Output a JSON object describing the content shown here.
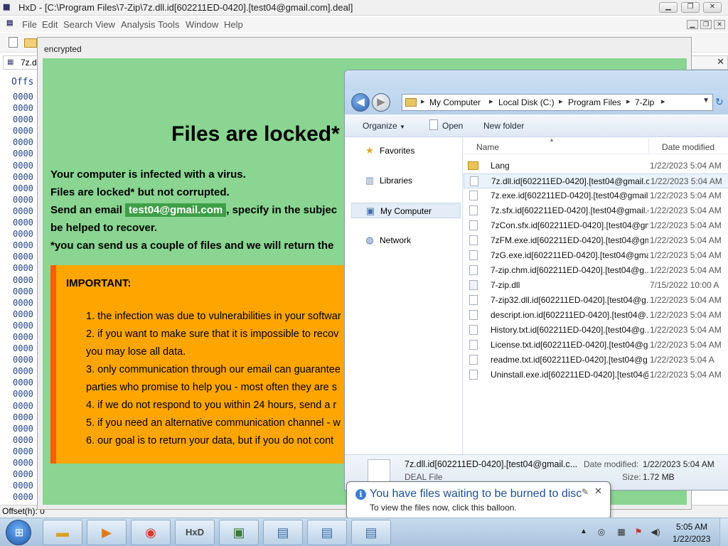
{
  "hxd": {
    "title": "HxD - [C:\\Program Files\\7-Zip\\7z.dll.id[602211ED-0420].[test04@gmail.com].deal]",
    "icon": "hxd-app-icon",
    "menu": [
      "File",
      "Edit",
      "Search",
      "View",
      "Analysis",
      "Tools",
      "Window",
      "Help"
    ],
    "tab_label": "7z.d",
    "offset_header": "Offs",
    "offset_rows": [
      "0000",
      "0000",
      "0000",
      "0000",
      "0000",
      "0000",
      "0000",
      "0000",
      "0000",
      "0000",
      "0000",
      "0000",
      "0000",
      "0000",
      "0000",
      "0000",
      "0000",
      "0000",
      "0000",
      "0000",
      "0000",
      "0000",
      "0000",
      "0000",
      "0000",
      "0000",
      "0000",
      "0000",
      "0000",
      "0000",
      "0000",
      "0000",
      "0000",
      "0000",
      "0000",
      "0000"
    ],
    "status_text": "Offset(h): 0"
  },
  "ransom": {
    "window_title": "encrypted",
    "heading": "Files are locked*",
    "line1": "Your computer is infected with a virus.",
    "line2": "Files are locked* but not corrupted.",
    "line3_pre": "Send an email",
    "email": "test04@gmail.com",
    "line3_post": ", specify in the subjec",
    "line4": "be helped to recover.",
    "line5": "*you can send us a couple of files and we will return the",
    "important_title": "IMPORTANT:",
    "important_lines": [
      "1. the infection was due to vulnerabilities in your softwar",
      "2. if you want to make sure that it is impossible to recov",
      "you may lose all data.",
      "3. only communication through our email can guarantee",
      "parties who promise to help you - most often they are s",
      "4. if we do not respond to you within 24 hours, send a r",
      "5. if you need an alternative communication channel - w",
      "6. our goal is to return your data, but if you do not cont"
    ],
    "colors": {
      "body": "#89d591",
      "important_bg": "#ffa500",
      "important_border": "#ff5a00",
      "email_highlight": "#3e9f47"
    }
  },
  "explorer": {
    "breadcrumb": [
      "My Computer",
      "Local Disk (C:)",
      "Program Files",
      "7-Zip"
    ],
    "commands": {
      "organize": "Organize",
      "open": "Open",
      "new_folder": "New folder"
    },
    "nav": [
      {
        "label": "Favorites",
        "icon": "star-icon"
      },
      {
        "label": "Libraries",
        "icon": "libraries-icon"
      },
      {
        "label": "My Computer",
        "icon": "computer-icon"
      },
      {
        "label": "Network",
        "icon": "network-icon"
      }
    ],
    "columns": {
      "name": "Name",
      "date": "Date modified"
    },
    "files": [
      {
        "name": "Lang",
        "date": "1/22/2023 5:04 AM",
        "type": "folder"
      },
      {
        "name": "7z.dll.id[602211ED-0420].[test04@gmail.c...",
        "date": "1/22/2023 5:04 AM",
        "type": "file",
        "selected": true
      },
      {
        "name": "7z.exe.id[602211ED-0420].[test04@gmail....",
        "date": "1/22/2023 5:04 AM",
        "type": "file"
      },
      {
        "name": "7z.sfx.id[602211ED-0420].[test04@gmail.c...",
        "date": "1/22/2023 5:04 AM",
        "type": "file"
      },
      {
        "name": "7zCon.sfx.id[602211ED-0420].[test04@gm...",
        "date": "1/22/2023 5:04 AM",
        "type": "file"
      },
      {
        "name": "7zFM.exe.id[602211ED-0420].[test04@gm...",
        "date": "1/22/2023 5:04 AM",
        "type": "file"
      },
      {
        "name": "7zG.exe.id[602211ED-0420].[test04@gmai...",
        "date": "1/22/2023 5:04 AM",
        "type": "file"
      },
      {
        "name": "7-zip.chm.id[602211ED-0420].[test04@g...",
        "date": "1/22/2023 5:04 AM",
        "type": "file"
      },
      {
        "name": "7-zip.dll",
        "date": "7/15/2022 10:00 A",
        "type": "dll"
      },
      {
        "name": "7-zip32.dll.id[602211ED-0420].[test04@g...",
        "date": "1/22/2023 5:04 AM",
        "type": "file"
      },
      {
        "name": "descript.ion.id[602211ED-0420].[test04@...",
        "date": "1/22/2023 5:04 AM",
        "type": "file"
      },
      {
        "name": "History.txt.id[602211ED-0420].[test04@g...",
        "date": "1/22/2023 5:04 AM",
        "type": "file"
      },
      {
        "name": "License.txt.id[602211ED-0420].[test04@g...",
        "date": "1/22/2023 5:04 AM",
        "type": "file"
      },
      {
        "name": "readme.txt.id[602211ED-0420].[test04@g...",
        "date": "1/22/2023 5:04 A",
        "type": "file",
        "hover": true
      },
      {
        "name": "Uninstall.exe.id[602211ED-0420].[test04@...",
        "date": "1/22/2023 5:04 AM",
        "type": "file"
      }
    ],
    "details": {
      "name": "7z.dll.id[602211ED-0420].[test04@gmail.c...",
      "type": "DEAL File",
      "date_modified_label": "Date modified:",
      "date_modified": "1/22/2023 5:04 AM",
      "size_label": "Size:",
      "size": "1.72 MB"
    }
  },
  "balloon": {
    "title": "You have files waiting to be burned to disc",
    "text": "To view the files now, click this balloon."
  },
  "taskbar": {
    "apps": [
      {
        "name": "explorer",
        "icon": "folder-icon"
      },
      {
        "name": "media-player",
        "icon": "media-player-icon"
      },
      {
        "name": "chrome",
        "icon": "chrome-icon"
      },
      {
        "name": "hxd",
        "icon": "hxd-icon"
      },
      {
        "name": "task-manager",
        "icon": "monitor-icon"
      },
      {
        "name": "setup-1",
        "icon": "installer-icon"
      },
      {
        "name": "setup-2",
        "icon": "installer-icon"
      },
      {
        "name": "setup-3",
        "icon": "installer-icon"
      }
    ],
    "time": "5:05 AM",
    "date": "1/22/2023"
  }
}
